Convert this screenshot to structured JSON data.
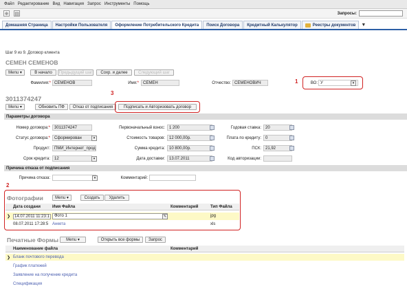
{
  "menu": [
    "Файл",
    "Редактирование",
    "Вид",
    "Навигация",
    "Запрос",
    "Инструменты",
    "Помощь"
  ],
  "toolbar": {
    "search_label": "Запросы:",
    "search_value": ""
  },
  "tabs": [
    {
      "label": "Домашняя Страница"
    },
    {
      "label": "Настройки Пользователя"
    },
    {
      "label": "Оформление Потребительского Кредита"
    },
    {
      "label": "Поиск Договора"
    },
    {
      "label": "Кредитный Калькулятор"
    },
    {
      "label": "Реестры документов"
    }
  ],
  "step": "Шаг 9 из 9. Договор клиента",
  "client": {
    "title": "СЕМЕН СЕМЕНОВ",
    "buttons": {
      "menu": "Menu",
      "start": "В начало",
      "prev": "Предыдущий шаг",
      "save_next": "Сохр. и далее",
      "next": "Следующий шаг"
    },
    "surname_label": "Фамилия:",
    "surname": "СЕМЕНОВ",
    "name_label": "Имя:",
    "name": "СЕМЕН",
    "patronymic_label": "Отчество:",
    "patronymic": "СЕМЕНОВИЧ",
    "vo_label": "ВО:",
    "vo": "У"
  },
  "contract": {
    "number_title": "3011374247",
    "buttons": {
      "menu": "Menu",
      "update_pf": "Обновить ПФ",
      "refuse": "Отказ от подписания",
      "sign": "Подписать и Авторизовать договор"
    },
    "params_header": "Параметры договора",
    "fields": {
      "number_label": "Номер договора:",
      "number": "3011374247",
      "status_label": "Статус договора:",
      "status": "Сформирован",
      "product_label": "Продукт:",
      "product": "ПМИ_Интернет_проду",
      "term_label": "Срок кредита:",
      "term": "12",
      "down_label": "Первоначальный взнос:",
      "down": "1 200",
      "goods_label": "Стоимость товаров:",
      "goods": "12 000,00р.",
      "sum_label": "Сумма кредита:",
      "sum": "10 800,00р.",
      "delivery_label": "Дата доставки:",
      "delivery": "13.07.2011",
      "rate_label": "Годовая ставка:",
      "rate": "20",
      "fee_label": "Плата по кредиту:",
      "fee": "0",
      "psk_label": "ПСК:",
      "psk": "21,92",
      "auth_label": "Код авторизации:",
      "auth": ""
    },
    "refuse_header": "Причина отказа от подписания",
    "refuse_reason_label": "Причина отказа:",
    "refuse_reason": "",
    "comment_label": "Комментарий:",
    "comment": ""
  },
  "photos": {
    "title": "Фотографии",
    "buttons": {
      "menu": "Menu",
      "create": "Создать",
      "delete": "Удалить"
    },
    "columns": [
      "Дата создани",
      "Имя Файла",
      "Комментарий",
      "Тип Файла"
    ],
    "rows": [
      {
        "date": "14.07.2011 11:23:1",
        "name": "Фото 1",
        "comment": "",
        "type": "jpg"
      },
      {
        "date": "08.07.2011 17:28:5",
        "name": "Анкета",
        "comment": "",
        "type": "xls"
      }
    ]
  },
  "print_forms": {
    "title": "Печатные Формы",
    "buttons": {
      "menu": "Menu",
      "open_all": "Открыть все формы",
      "query": "Запрос"
    },
    "columns": [
      "Наименование файла",
      "Комментарий"
    ],
    "rows": [
      "Бланк почтового перевода",
      "График платежей",
      "Заявление на получение кредита",
      "Спецификация"
    ]
  },
  "annotations": [
    "1",
    "2",
    "3"
  ],
  "colors": {
    "accent": "#2b5ea6",
    "highlight": "#fdf9c6",
    "annotation": "#d02020"
  }
}
